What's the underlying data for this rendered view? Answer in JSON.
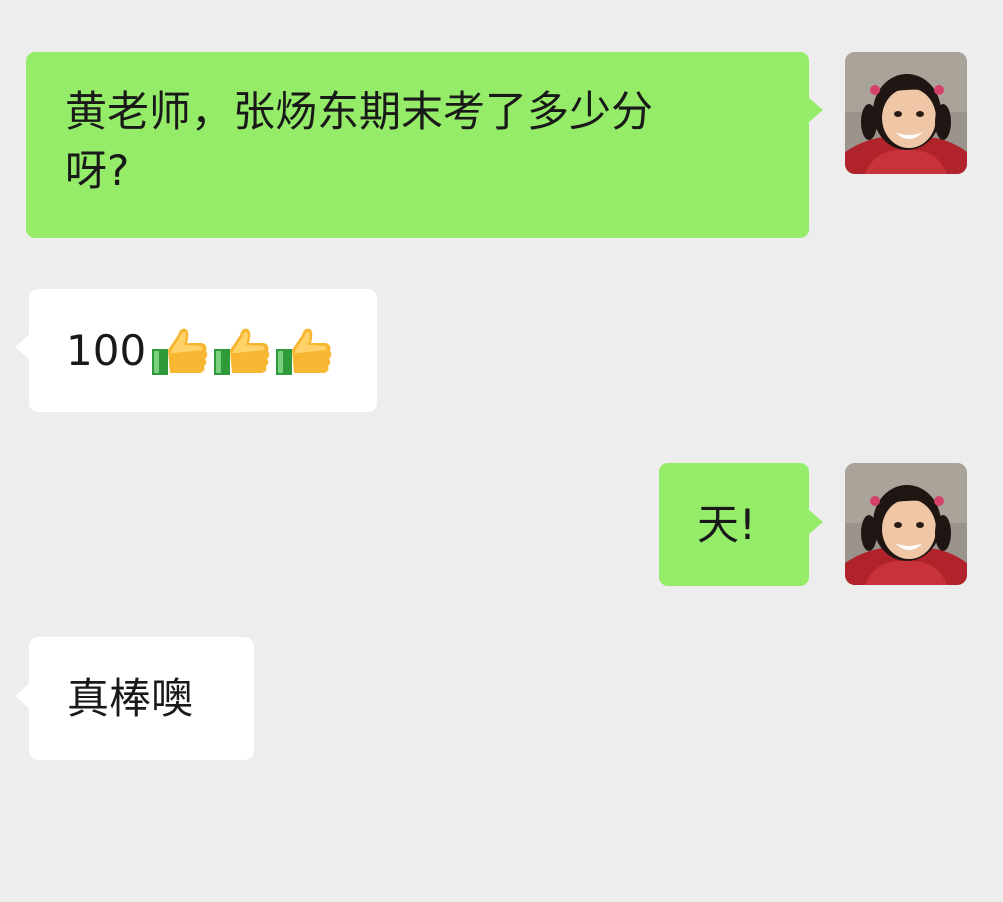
{
  "messages": [
    {
      "side": "sent",
      "text": "黄老师，张炀东期末考了多少分\n呀?"
    },
    {
      "side": "received",
      "text": "100",
      "emoji": [
        "thumbs-up",
        "thumbs-up",
        "thumbs-up"
      ]
    },
    {
      "side": "sent",
      "text": "天!"
    },
    {
      "side": "received",
      "text": "真棒噢"
    }
  ],
  "colors": {
    "background": "#ededed",
    "sent_bubble": "#95ec69",
    "received_bubble": "#ffffff",
    "text": "#191919"
  }
}
